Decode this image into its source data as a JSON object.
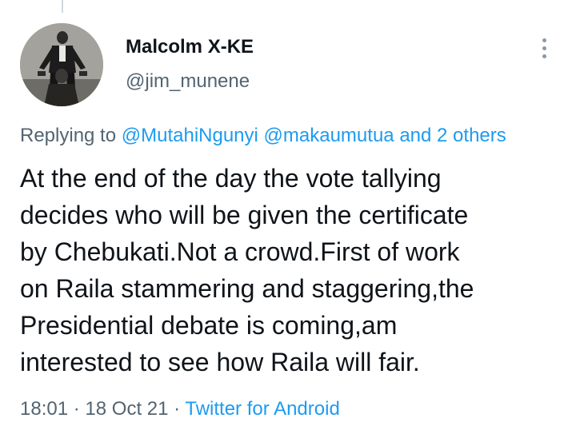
{
  "author": {
    "display_name": "Malcolm X-KE",
    "handle": "@jim_munene"
  },
  "reply_context": {
    "prefix": "Replying to",
    "mention_1": "@MutahiNgunyi",
    "mention_2": "@makaumutua",
    "conjunction": "and",
    "others": "2 others"
  },
  "tweet": {
    "lines": [
      "At the end of the day the vote tallying",
      "decides who will be given the certificate",
      "by Chebukati.Not a crowd.First of work",
      "on Raila stammering and staggering,the",
      "Presidential debate is coming,am",
      "interested to see how Raila will fair."
    ]
  },
  "meta": {
    "time": "18:01",
    "separator": "·",
    "date": "18 Oct 21",
    "source": "Twitter for Android"
  },
  "icons": {
    "more": "more-vertical-icon"
  },
  "colors": {
    "link": "#1d9bf0",
    "secondary_text": "#536471",
    "primary_text": "#0f1419"
  }
}
